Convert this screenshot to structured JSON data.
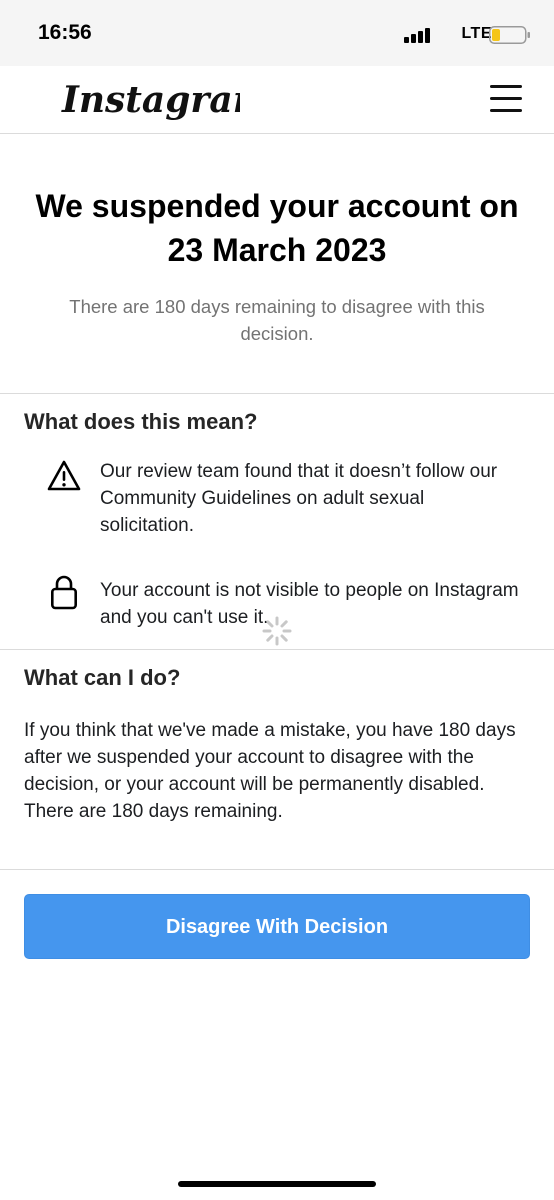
{
  "status_bar": {
    "time": "16:56",
    "network": "LTE",
    "battery_color": "#f5c518",
    "icons": [
      "signal-icon",
      "battery-icon"
    ]
  },
  "header": {
    "logo_text": "Instagram",
    "menu_icon": "hamburger-menu-icon"
  },
  "hero": {
    "title": "We suspended your account on 23 March 2023",
    "subtitle": "There are 180 days remaining to disagree with this decision."
  },
  "meaning": {
    "heading": "What does this mean?",
    "items": [
      {
        "icon": "warning-icon",
        "text": "Our review team found that it doesn’t follow our Community Guidelines on adult sexual solicitation."
      },
      {
        "icon": "lock-icon",
        "text": "Your account is not visible to people on Instagram and you can't use it."
      }
    ]
  },
  "actions": {
    "heading": "What can I do?",
    "body": "If you think that we've made a mistake, you have 180 days after we suspended your account to disagree with the decision, or your account will be permanently disabled. There are 180 days remaining."
  },
  "cta": {
    "label": "Disagree With Decision",
    "color": "#4596ee"
  }
}
